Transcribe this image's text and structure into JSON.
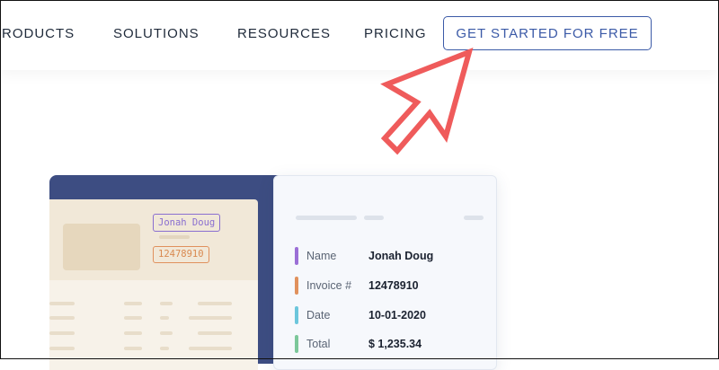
{
  "nav": {
    "items": [
      "RODUCTS",
      "SOLUTIONS",
      "RESOURCES",
      "PRICING"
    ],
    "cta_label": "GET STARTED FOR FREE"
  },
  "invoice_illustration": {
    "name_tag": "Jonah Doug",
    "invoice_tag": "12478910"
  },
  "extracted_fields": [
    {
      "label": "Name",
      "value": "Jonah Doug",
      "color": "#9b6fd6"
    },
    {
      "label": "Invoice #",
      "value": "12478910",
      "color": "#e0915d"
    },
    {
      "label": "Date",
      "value": "10-01-2020",
      "color": "#6cc6dc"
    },
    {
      "label": "Total",
      "value": "$ 1,235.34",
      "color": "#7cc79a"
    }
  ],
  "colors": {
    "accent": "#3b5aa7",
    "arrow": "#ef5b5b",
    "illustration_bg": "#3d4d82"
  },
  "icons": {
    "pointer": "cursor-arrow-icon"
  }
}
